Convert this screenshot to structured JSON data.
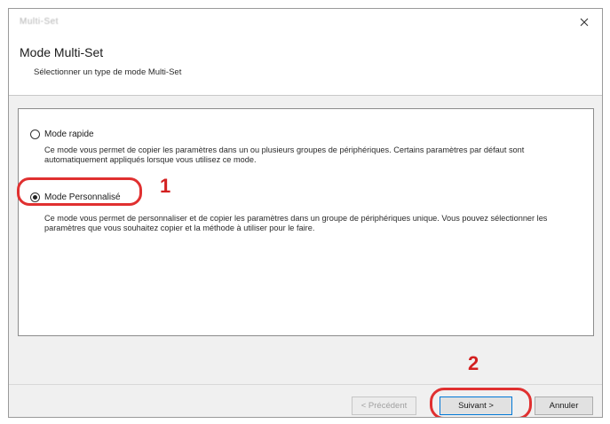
{
  "window": {
    "title": "Multi-Set",
    "close_glyph": "×"
  },
  "header": {
    "title": "Mode Multi-Set",
    "subtitle": "Sélectionner un type de mode Multi-Set"
  },
  "options": [
    {
      "label": "Mode rapide",
      "selected": false,
      "description": "Ce mode vous permet de copier les paramètres dans un ou plusieurs groupes de périphériques. Certains paramètres par défaut sont automatiquement appliqués lorsque vous utilisez ce mode."
    },
    {
      "label": "Mode Personnalisé",
      "selected": true,
      "description": "Ce mode vous permet de personnaliser et de copier les paramètres dans un groupe de périphériques unique. Vous pouvez sélectionner les paramètres que vous souhaitez copier et la méthode à utiliser pour le faire."
    }
  ],
  "callouts": {
    "one": "1",
    "two": "2"
  },
  "buttons": {
    "previous": "< Précédent",
    "next": "Suivant >",
    "cancel": "Annuler"
  },
  "colors": {
    "callout": "#d32020",
    "default_button_border": "#0078d7"
  }
}
